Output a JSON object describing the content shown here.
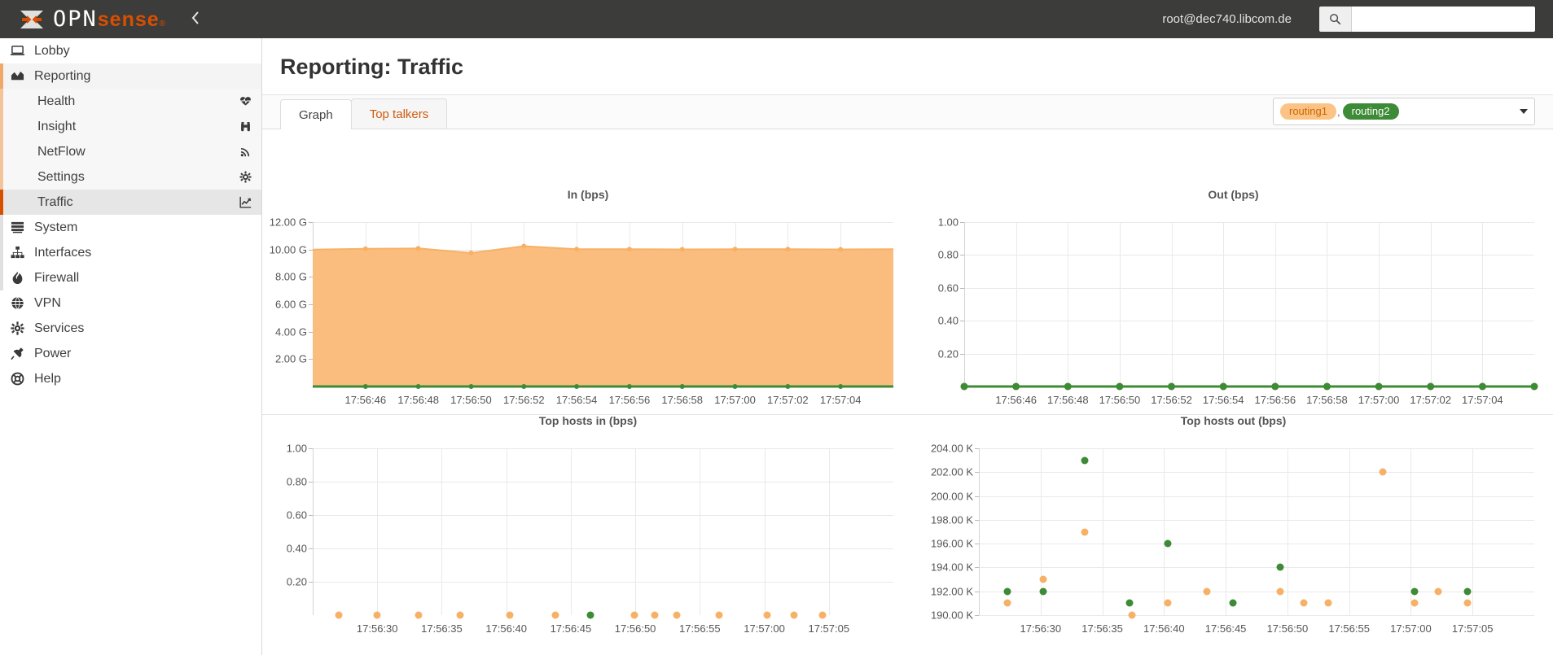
{
  "topbar": {
    "logo_opn": "OPN",
    "logo_sense": "sense",
    "logo_reg": "®",
    "collapse_icon": "chevron-left-icon",
    "user": "root@dec740.libcom.de",
    "search_icon": "search-icon",
    "search_value": "",
    "search_placeholder": ""
  },
  "sidebar": {
    "items": [
      {
        "label": "Lobby",
        "icon": "laptop-icon",
        "level": "top",
        "state": "normal"
      },
      {
        "label": "Reporting",
        "icon": "chart-area-icon",
        "level": "top",
        "state": "open"
      },
      {
        "label": "Health",
        "icon": "heartbeat-icon",
        "level": "sub",
        "state": "normal"
      },
      {
        "label": "Insight",
        "icon": "binoculars-icon",
        "level": "sub",
        "state": "normal"
      },
      {
        "label": "NetFlow",
        "icon": "rss-icon",
        "level": "sub",
        "state": "normal"
      },
      {
        "label": "Settings",
        "icon": "gear-icon",
        "level": "sub",
        "state": "normal"
      },
      {
        "label": "Traffic",
        "icon": "chart-line-icon",
        "level": "sub",
        "state": "active"
      },
      {
        "label": "System",
        "icon": "server-icon",
        "level": "top",
        "state": "normal"
      },
      {
        "label": "Interfaces",
        "icon": "sitemap-icon",
        "level": "top",
        "state": "normal"
      },
      {
        "label": "Firewall",
        "icon": "fire-icon",
        "level": "top",
        "state": "normal"
      },
      {
        "label": "VPN",
        "icon": "globe-icon",
        "level": "top",
        "state": "normal"
      },
      {
        "label": "Services",
        "icon": "cog-icon",
        "level": "top",
        "state": "normal"
      },
      {
        "label": "Power",
        "icon": "plug-icon",
        "level": "top",
        "state": "normal"
      },
      {
        "label": "Help",
        "icon": "lifebuoy-icon",
        "level": "top",
        "state": "normal"
      }
    ]
  },
  "page": {
    "title": "Reporting: Traffic",
    "tabs": [
      {
        "label": "Graph",
        "active": true
      },
      {
        "label": "Top talkers",
        "active": false
      }
    ],
    "interface_select": {
      "badges": [
        {
          "label": "routing1",
          "style": "orange"
        },
        {
          "label": "routing2",
          "style": "green"
        }
      ],
      "separator": ",",
      "caret_icon": "chevron-down-icon"
    }
  },
  "colors": {
    "accent_orange": "#d94f00",
    "series_orange": "#f7b166",
    "series_orange_fill": "#fbbd7e",
    "series_green": "#3d8b36",
    "grid": "#e9e9e9",
    "badge_green": "#3d8b36",
    "badge_orange_bg": "#fbc486",
    "badge_orange_text": "#cc6600"
  },
  "chart_data": [
    {
      "id": "in-bps",
      "type": "area",
      "title": "In (bps)",
      "xlabel": "",
      "ylabel": "",
      "ylim": [
        0,
        12000000000
      ],
      "ytick_labels": [
        "12.00 G",
        "10.00 G",
        "8.00 G",
        "6.00 G",
        "4.00 G",
        "2.00 G"
      ],
      "ytick_values": [
        12000000000,
        10000000000,
        8000000000,
        6000000000,
        4000000000,
        2000000000
      ],
      "xtick_labels": [
        "17:56:46",
        "17:56:48",
        "17:56:50",
        "17:56:52",
        "17:56:54",
        "17:56:56",
        "17:56:58",
        "17:57:00",
        "17:57:02",
        "17:57:04"
      ],
      "grid": true,
      "legend": "none",
      "series": [
        {
          "name": "routing1",
          "color": "#f7b166",
          "fill": "#fbbd7e",
          "values": [
            10000000000,
            10050000000,
            10080000000,
            9750000000,
            10250000000,
            10020000000,
            10020000000,
            10010000000,
            10020000000,
            10020000000,
            10010000000,
            10020000000
          ]
        },
        {
          "name": "routing2",
          "color": "#3d8b36",
          "fill": "none",
          "values": [
            0,
            0,
            0,
            0,
            0,
            0,
            0,
            0,
            0,
            0,
            0,
            0
          ]
        }
      ]
    },
    {
      "id": "out-bps",
      "type": "line",
      "title": "Out (bps)",
      "xlabel": "",
      "ylabel": "",
      "ylim": [
        0,
        1.0
      ],
      "ytick_labels": [
        "1.00",
        "0.80",
        "0.60",
        "0.40",
        "0.20"
      ],
      "ytick_values": [
        1.0,
        0.8,
        0.6,
        0.4,
        0.2
      ],
      "xtick_labels": [
        "17:56:46",
        "17:56:48",
        "17:56:50",
        "17:56:52",
        "17:56:54",
        "17:56:56",
        "17:56:58",
        "17:57:00",
        "17:57:02",
        "17:57:04"
      ],
      "grid": true,
      "legend": "none",
      "series": [
        {
          "name": "routing1",
          "color": "#f7b166",
          "fill": "none",
          "values": [
            0,
            0,
            0,
            0,
            0,
            0,
            0,
            0,
            0,
            0,
            0,
            0
          ]
        },
        {
          "name": "routing2",
          "color": "#3d8b36",
          "fill": "none",
          "values": [
            0,
            0,
            0,
            0,
            0,
            0,
            0,
            0,
            0,
            0,
            0,
            0
          ]
        }
      ]
    },
    {
      "id": "top-hosts-in",
      "type": "scatter",
      "title": "Top hosts in (bps)",
      "xlabel": "",
      "ylabel": "",
      "ylim": [
        0,
        1.0
      ],
      "ytick_labels": [
        "1.00",
        "0.80",
        "0.60",
        "0.40",
        "0.20"
      ],
      "ytick_values": [
        1.0,
        0.8,
        0.6,
        0.4,
        0.2
      ],
      "xtick_labels": [
        "17:56:30",
        "17:56:35",
        "17:56:40",
        "17:56:45",
        "17:56:50",
        "17:56:55",
        "17:57:00",
        "17:57:05"
      ],
      "grid": true,
      "legend": "none",
      "points": [
        {
          "x": 27.0,
          "y": 0,
          "color": "#f7b166"
        },
        {
          "x": 30.0,
          "y": 0,
          "color": "#f7b166"
        },
        {
          "x": 33.2,
          "y": 0,
          "color": "#f7b166"
        },
        {
          "x": 36.4,
          "y": 0,
          "color": "#f7b166"
        },
        {
          "x": 40.3,
          "y": 0,
          "color": "#f7b166"
        },
        {
          "x": 43.8,
          "y": 0,
          "color": "#f7b166"
        },
        {
          "x": 46.5,
          "y": 0,
          "color": "#3d8b36"
        },
        {
          "x": 49.9,
          "y": 0,
          "color": "#f7b166"
        },
        {
          "x": 51.5,
          "y": 0,
          "color": "#f7b166"
        },
        {
          "x": 53.2,
          "y": 0,
          "color": "#f7b166"
        },
        {
          "x": 56.5,
          "y": 0,
          "color": "#f7b166"
        },
        {
          "x": 60.2,
          "y": 0,
          "color": "#f7b166"
        },
        {
          "x": 62.3,
          "y": 0,
          "color": "#f7b166"
        },
        {
          "x": 64.5,
          "y": 0,
          "color": "#f7b166"
        }
      ]
    },
    {
      "id": "top-hosts-out",
      "type": "scatter",
      "title": "Top hosts out (bps)",
      "xlabel": "",
      "ylabel": "",
      "ylim": [
        190000,
        204000
      ],
      "ytick_labels": [
        "204.00 K",
        "202.00 K",
        "200.00 K",
        "198.00 K",
        "196.00 K",
        "194.00 K",
        "192.00 K",
        "190.00 K"
      ],
      "ytick_values": [
        204000,
        202000,
        200000,
        198000,
        196000,
        194000,
        192000,
        190000
      ],
      "xtick_labels": [
        "17:56:30",
        "17:56:35",
        "17:56:40",
        "17:56:45",
        "17:56:50",
        "17:56:55",
        "17:57:00",
        "17:57:05"
      ],
      "grid": true,
      "legend": "none",
      "points": [
        {
          "x": 27.3,
          "y": 192000,
          "color": "#3d8b36"
        },
        {
          "x": 27.3,
          "y": 191000,
          "color": "#f7b166"
        },
        {
          "x": 30.2,
          "y": 193000,
          "color": "#f7b166"
        },
        {
          "x": 30.2,
          "y": 192000,
          "color": "#3d8b36"
        },
        {
          "x": 33.6,
          "y": 203000,
          "color": "#3d8b36"
        },
        {
          "x": 33.6,
          "y": 197000,
          "color": "#f7b166"
        },
        {
          "x": 37.2,
          "y": 191000,
          "color": "#3d8b36"
        },
        {
          "x": 37.4,
          "y": 190000,
          "color": "#f7b166"
        },
        {
          "x": 40.3,
          "y": 196000,
          "color": "#3d8b36"
        },
        {
          "x": 40.3,
          "y": 191000,
          "color": "#f7b166"
        },
        {
          "x": 43.5,
          "y": 192000,
          "color": "#f7b166"
        },
        {
          "x": 45.6,
          "y": 191000,
          "color": "#3d8b36"
        },
        {
          "x": 49.4,
          "y": 194000,
          "color": "#3d8b36"
        },
        {
          "x": 49.4,
          "y": 192000,
          "color": "#f7b166"
        },
        {
          "x": 51.3,
          "y": 191000,
          "color": "#f7b166"
        },
        {
          "x": 53.3,
          "y": 191000,
          "color": "#f7b166"
        },
        {
          "x": 57.7,
          "y": 202000,
          "color": "#f7b166"
        },
        {
          "x": 60.3,
          "y": 192000,
          "color": "#3d8b36"
        },
        {
          "x": 60.3,
          "y": 191000,
          "color": "#f7b166"
        },
        {
          "x": 62.2,
          "y": 192000,
          "color": "#f7b166"
        },
        {
          "x": 64.6,
          "y": 192000,
          "color": "#3d8b36"
        },
        {
          "x": 64.6,
          "y": 191000,
          "color": "#f7b166"
        }
      ]
    }
  ]
}
